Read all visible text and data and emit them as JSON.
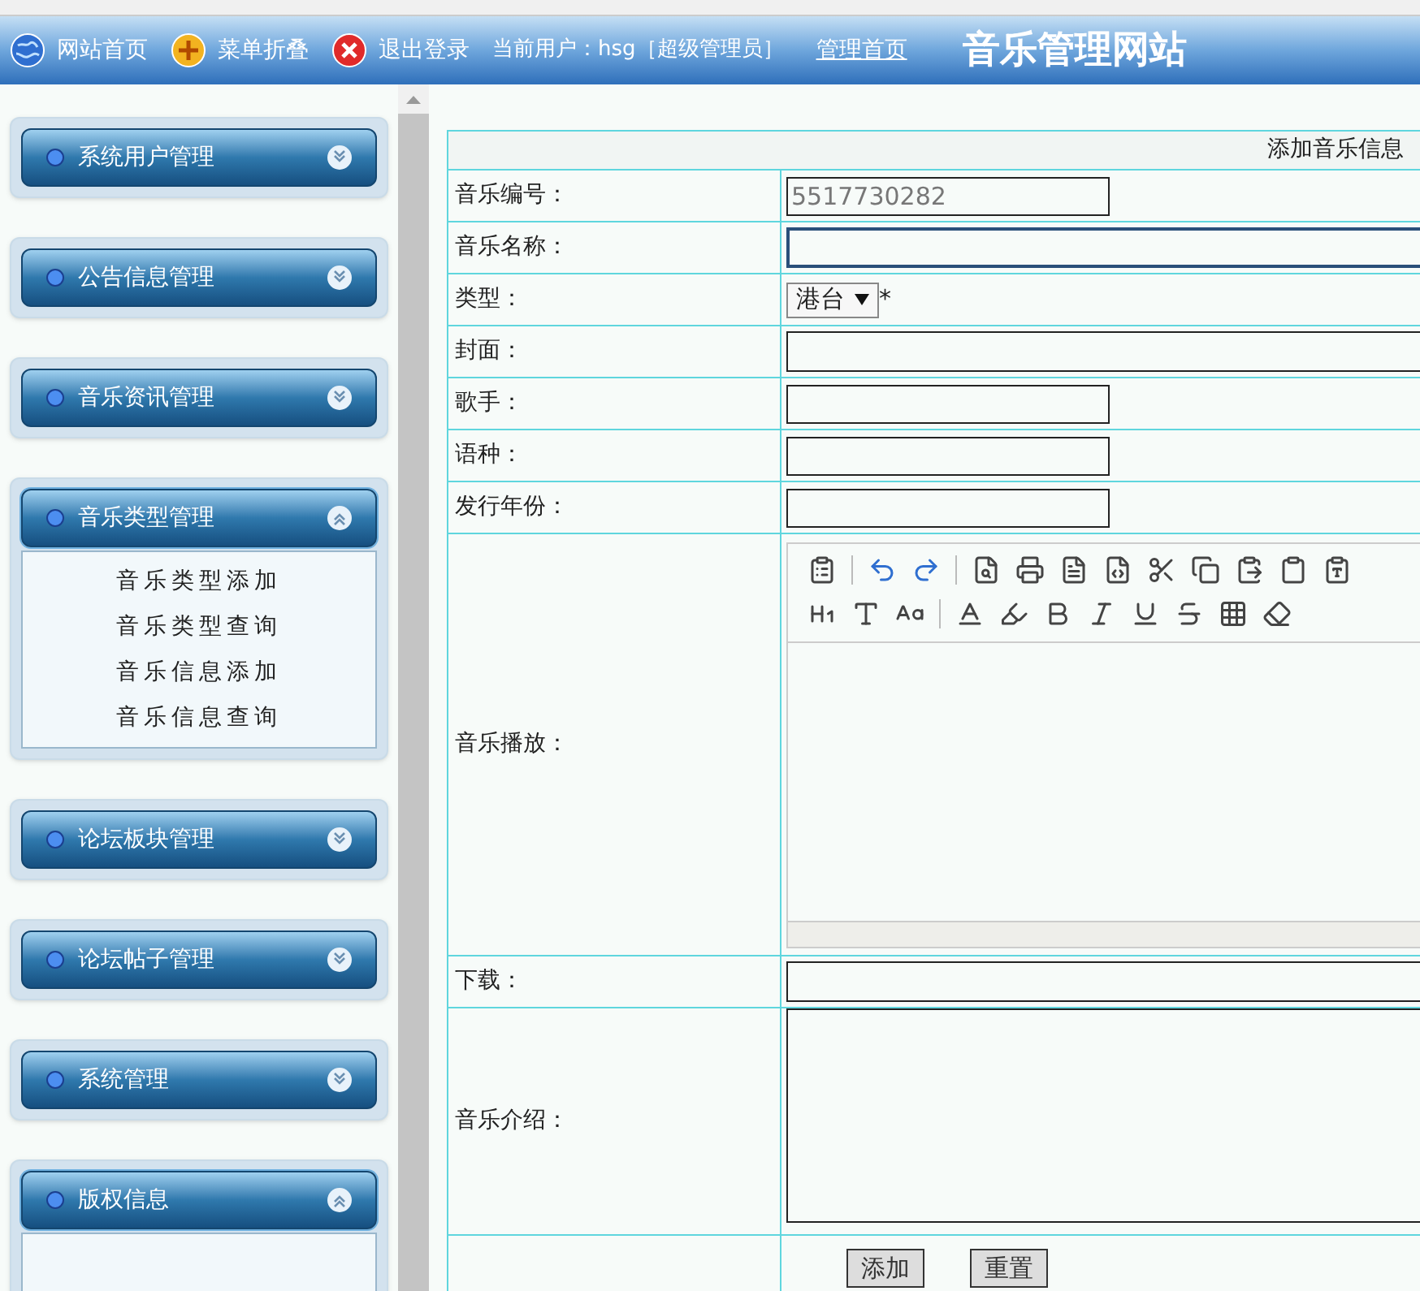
{
  "header": {
    "links": [
      {
        "label": "网站首页",
        "kind": "home"
      },
      {
        "label": "菜单折叠",
        "kind": "collapse"
      },
      {
        "label": "退出登录",
        "kind": "logout"
      }
    ],
    "current_user": "当前用户：hsg［超级管理员］",
    "admin_link": "管理首页",
    "site_title": "音乐管理网站"
  },
  "sidebar": {
    "sections": [
      {
        "label": "系统用户管理",
        "expanded": false
      },
      {
        "label": "公告信息管理",
        "expanded": false
      },
      {
        "label": "音乐资讯管理",
        "expanded": false
      },
      {
        "label": "音乐类型管理",
        "expanded": true,
        "children": [
          "音乐类型添加",
          "音乐类型查询",
          "音乐信息添加",
          "音乐信息查询"
        ]
      },
      {
        "label": "论坛板块管理",
        "expanded": false
      },
      {
        "label": "论坛帖子管理",
        "expanded": false
      },
      {
        "label": "系统管理",
        "expanded": false
      },
      {
        "label": "版权信息",
        "expanded": true
      }
    ]
  },
  "form": {
    "title": "添加音乐信息",
    "rows": [
      {
        "label": "音乐编号：",
        "kind": "short",
        "value": "5517730282"
      },
      {
        "label": "音乐名称：",
        "kind": "wide",
        "focused": true
      },
      {
        "label": "类型：",
        "kind": "select",
        "value": "港台",
        "required_mark": "*"
      },
      {
        "label": "封面：",
        "kind": "wide",
        "focused": false
      },
      {
        "label": "歌手：",
        "kind": "short"
      },
      {
        "label": "语种：",
        "kind": "short"
      },
      {
        "label": "发行年份：",
        "kind": "short"
      },
      {
        "label": "音乐播放：",
        "kind": "editor"
      },
      {
        "label": "下载：",
        "kind": "wide",
        "focused": false
      },
      {
        "label": "音乐介绍：",
        "kind": "textarea"
      }
    ],
    "buttons": [
      "添加",
      "重置"
    ]
  }
}
